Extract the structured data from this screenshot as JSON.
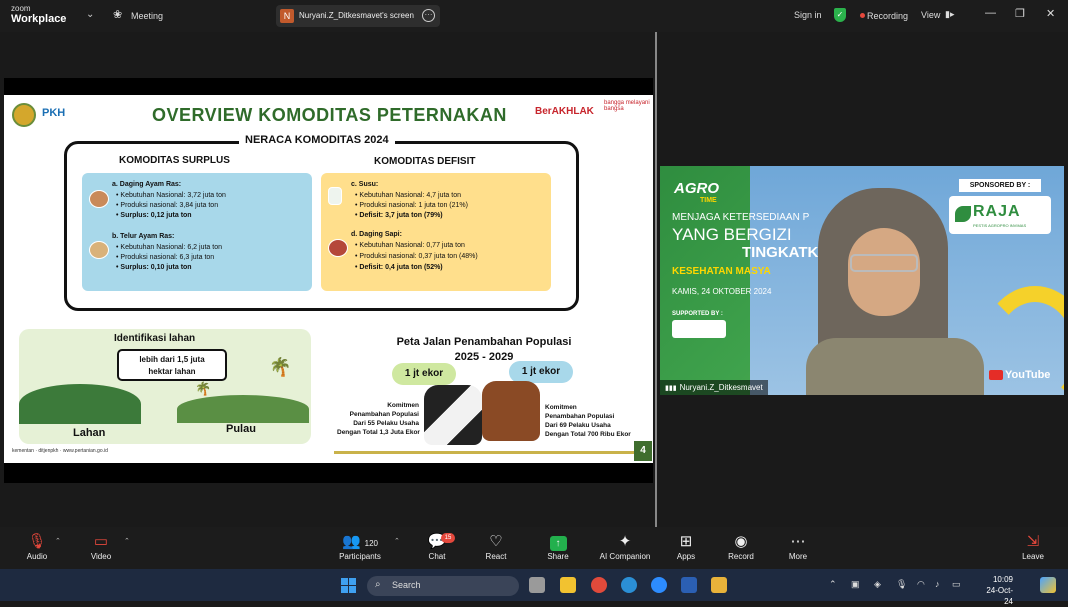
{
  "top_bar": {
    "brand_top": "zoom",
    "brand_name": "Workplace",
    "meeting_label": "Meeting",
    "share_badge": "N",
    "share_label": "Nuryani.Z_Ditkesmavet's screen",
    "sign_in": "Sign in",
    "recording": "Recording",
    "view": "View"
  },
  "slide": {
    "logo_text": "PKH",
    "title": "OVERVIEW KOMODITAS PETERNAKAN",
    "berakhlak": "BerAKHLAK",
    "bangga": "bangga melayani bangsa",
    "neraca_title": "NERACA KOMODITAS 2024",
    "surplus": {
      "heading": "KOMODITAS SURPLUS",
      "items": [
        {
          "title": "a. Daging Ayam Ras:",
          "lines": [
            "Kebutuhan Nasional: 3,72 juta ton",
            "Produksi nasional: 3,84 juta ton",
            "Surplus: 0,12 juta ton"
          ]
        },
        {
          "title": "b. Telur Ayam Ras:",
          "lines": [
            "Kebutuhan Nasional: 6,2 juta ton",
            "Produksi nasional: 6,3 juta ton",
            "Surplus: 0,10 juta ton"
          ]
        }
      ]
    },
    "defisit": {
      "heading": "KOMODITAS DEFISIT",
      "items": [
        {
          "title": "c. Susu:",
          "lines": [
            "Kebutuhan Nasional: 4,7 juta ton",
            "Produksi nasional: 1 juta ton (21%)",
            "Defisit: 3,7 juta ton (79%)"
          ]
        },
        {
          "title": "d. Daging Sapi:",
          "lines": [
            "Kebutuhan Nasional: 0,77 juta ton",
            "Produksi nasional: 0,37 juta ton (48%)",
            "Defisit: 0,4 juta ton (52%)"
          ]
        }
      ]
    },
    "lahan": {
      "title": "Identifikasi lahan",
      "tag_line1": "lebih dari 1,5 juta",
      "tag_line2": "hektar lahan",
      "label_left": "Lahan",
      "label_right": "Pulau"
    },
    "peta": {
      "title_line1": "Peta Jalan Penambahan Populasi",
      "title_line2": "2025 - 2029",
      "bubble_left": "1 jt ekor",
      "bubble_right": "1 jt ekor",
      "komit_left": [
        "Komitmen",
        "Penambahan Populasi",
        "Dari 55 Pelaku Usaha",
        "Dengan Total 1,3 Juta Ekor"
      ],
      "komit_right": [
        "Komitmen",
        "Penambahan Populasi",
        "Dari 69 Pelaku Usaha",
        "Dengan Total 700 Ribu Ekor"
      ]
    },
    "page_number": "4",
    "footer": "kementan · ditjenpkh · www.pertanian.go.id"
  },
  "video": {
    "agro": "AGRO",
    "time": "TIME",
    "line1": "MENJAGA KETERSEDIAAN P",
    "line2": "YANG BERGIZI",
    "line3": "TINGKATKAN",
    "line4": "KESEHATAN MASYA",
    "date": "KAMIS, 24 OKTOBER 2024",
    "supported": "SUPPORTED BY :",
    "sponsored": "SPONSORED BY :",
    "raja": "RAJA",
    "raja_sub": "PESTIS AGROPRO INVIMAS",
    "youtube": "YouTube",
    "participant_name": "Nuryani.Z_Ditkesmavet"
  },
  "toolbar": {
    "audio": "Audio",
    "video": "Video",
    "participants": "Participants",
    "participants_count": "120",
    "chat": "Chat",
    "chat_badge": "15",
    "react": "React",
    "share": "Share",
    "ai_companion": "AI Companion",
    "apps": "Apps",
    "record": "Record",
    "more": "More",
    "leave": "Leave"
  },
  "taskbar": {
    "search_placeholder": "Search",
    "time": "10:09",
    "date": "24-Oct-24"
  },
  "colors": {
    "zoom_bg": "#1c1c1c",
    "record_red": "#e5483c",
    "slide_green": "#2f6b2a",
    "surplus_card": "#a8d8ea",
    "defisit_card": "#ffdf8c"
  }
}
